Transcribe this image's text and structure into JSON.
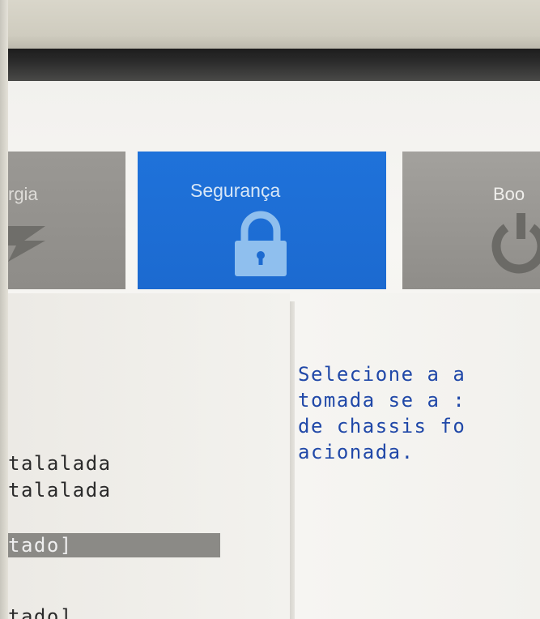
{
  "tabs": [
    {
      "id": "energia",
      "label": "rgia",
      "icon": "lightning-bolt-icon"
    },
    {
      "id": "seguranca",
      "label": "Segurança",
      "icon": "lock-icon",
      "active": true
    },
    {
      "id": "boot",
      "label": "Boo",
      "icon": "power-icon"
    }
  ],
  "left_panel": {
    "lines": [
      "talalada",
      "talalada"
    ],
    "selected_field": "tado]",
    "bottom_line": "tado]"
  },
  "help_text": {
    "lines": [
      "Selecione a a",
      "tomada se a :",
      "de chassis fo",
      "acionada."
    ]
  },
  "colors": {
    "active_tab": "#1d6ed6",
    "inactive_tab": "#8e8c88",
    "help_text": "#2048a8",
    "selected_field_bg": "#8b8a86"
  }
}
